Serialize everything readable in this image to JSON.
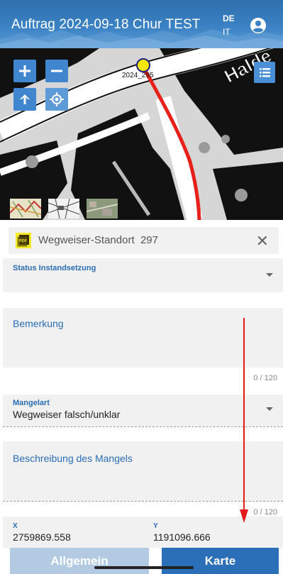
{
  "header": {
    "title": "Auftrag 2024-09-18 Chur TEST",
    "lang_primary": "DE",
    "lang_secondary": "IT",
    "user_icon": "user-circle-icon"
  },
  "map": {
    "zoom_in_icon": "plus-icon",
    "zoom_out_icon": "minus-icon",
    "north_icon": "arrow-up-icon",
    "locate_icon": "locate-icon",
    "layers_icon": "list-icon",
    "pin_label": "2024_295",
    "street_label": "Halde",
    "thumbnails": [
      {
        "marker": "*"
      },
      {
        "marker": "*"
      },
      {
        "marker": "*"
      }
    ],
    "route_color": "#e8201a",
    "pin_color": "#f5e50a"
  },
  "object": {
    "icon": "pdf-icon",
    "name": "Wegweiser-Standort",
    "number": "297",
    "close_icon": "close-icon"
  },
  "form": {
    "status_label": "Status Instandsetzung",
    "status_value": "",
    "bemerkung_label": "Bemerkung",
    "bemerkung_counter": "0 / 120",
    "mangelart_label": "Mangelart",
    "mangelart_value": "Wegweiser falsch/unklar",
    "beschreibung_label": "Beschreibung des Mangels",
    "beschreibung_counter": "0 / 120",
    "x_label": "X",
    "x_value": "2759869.558",
    "y_label": "Y",
    "y_value": "1191096.666"
  },
  "footer": {
    "tab_general": "Allgemein",
    "tab_map": "Karte"
  },
  "colors": {
    "header_blue": "#3a82c4",
    "accent_blue": "#2a6fb8",
    "label_blue": "#2a6db5",
    "annotation_red": "#e3191c"
  }
}
